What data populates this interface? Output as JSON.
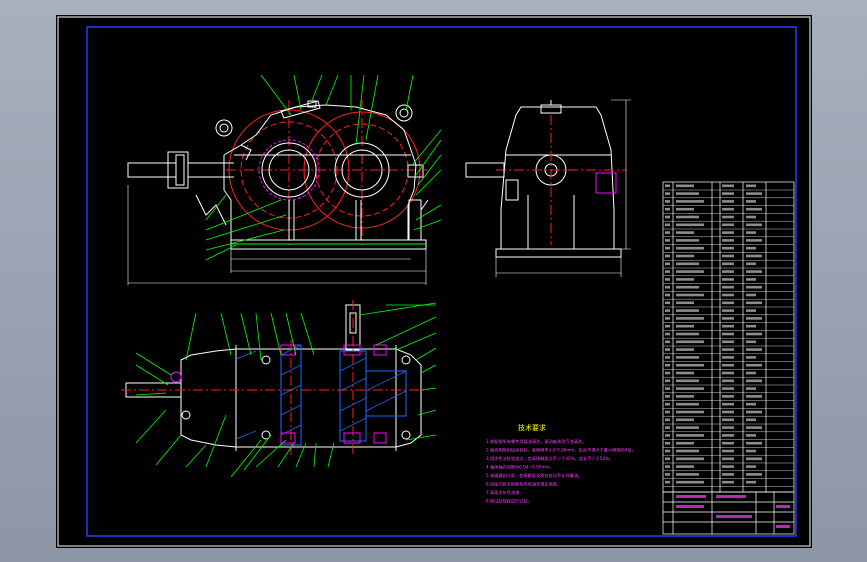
{
  "colors": {
    "viewport_bg": "#8d96a6",
    "sheet_bg": "#000000",
    "frame": "#2a3df0",
    "outline": "#ffffff",
    "leader": "#00ff00",
    "center_line": "#ff2020",
    "hatch": "#1e6cff",
    "bearing": "#ff00ff",
    "text": "#ffff00"
  },
  "icons": [
    "front-view",
    "side-view",
    "plan-view"
  ],
  "notes": {
    "title": "技术要求",
    "lines": [
      "1.装配前所有零件用煤油清洗，滚动轴承用汽油清洗。",
      "2.啮合侧隙用铅丝检验，其侧隙不小于0.16mm，铅丝不得大于最小侧隙的4倍。",
      "3.用涂色法检验斑点，齿高接触斑点不少于40%，齿长不少于50%。",
      "4.轴承轴向间隙为0.04~0.07mm。",
      "5.减速器剖分面、各接触面及密封处均不允许漏油。",
      "6.机座内装全损耗系统用油至规定高度。",
      "7.表面涂灰色油漆。",
      "8.按试验规程进行试验。"
    ]
  }
}
